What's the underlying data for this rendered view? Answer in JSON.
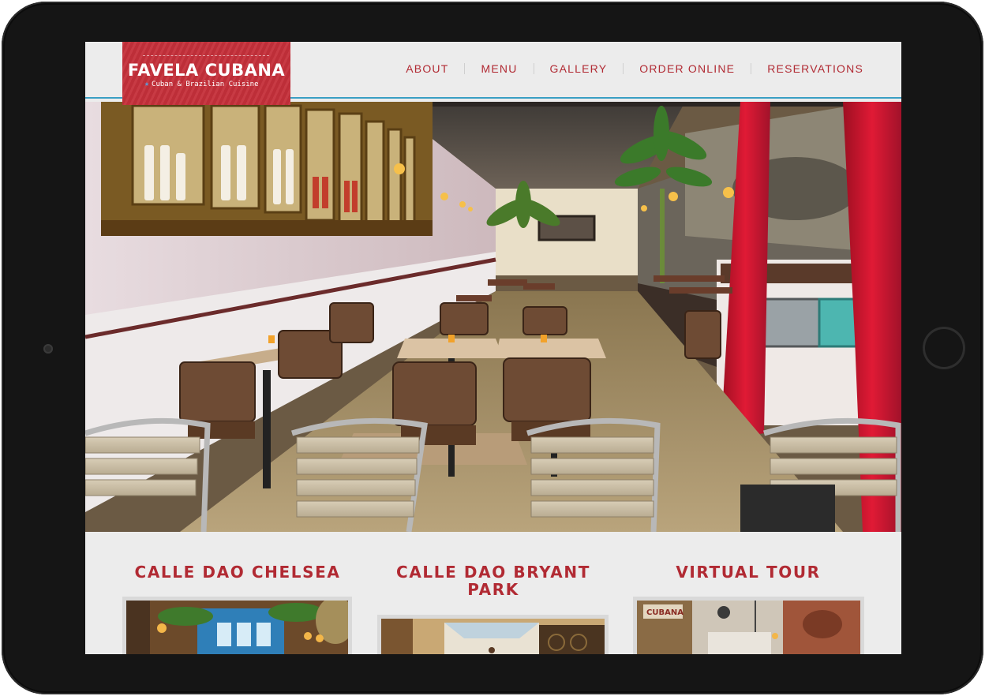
{
  "logo": {
    "name": "FAVELA CUBANA",
    "tagline": "Cuban & Brazilian Cuisine"
  },
  "nav": {
    "items": [
      {
        "label": "ABOUT"
      },
      {
        "label": "MENU"
      },
      {
        "label": "GALLERY"
      },
      {
        "label": "ORDER ONLINE"
      },
      {
        "label": "RESERVATIONS"
      }
    ]
  },
  "sections": [
    {
      "title": "CALLE DAO CHELSEA"
    },
    {
      "title": "CALLE DAO BRYANT PARK"
    },
    {
      "title": "VIRTUAL TOUR"
    }
  ],
  "colors": {
    "brand_red": "#b12a33",
    "logo_bg": "#c5303a",
    "accent_blue": "#3a9fc4",
    "page_bg": "#ececec"
  },
  "icons": {
    "logo_star": "star-icon",
    "home_button": "home-button-icon"
  }
}
